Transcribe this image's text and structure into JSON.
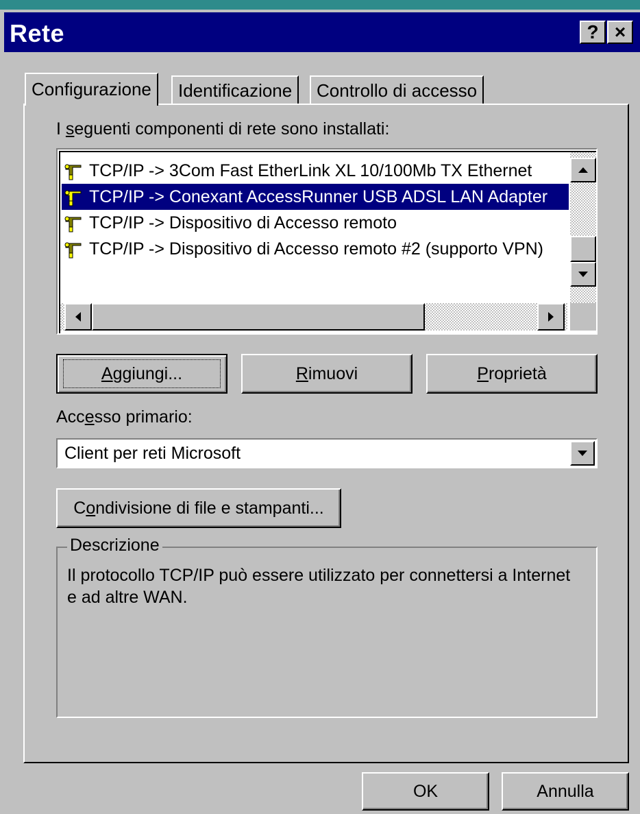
{
  "window": {
    "title": "Rete",
    "help_button": "?",
    "close_button": "×"
  },
  "tabs": [
    {
      "label": "Configurazione",
      "active": true
    },
    {
      "label": "Identificazione",
      "active": false
    },
    {
      "label": "Controllo di accesso",
      "active": false
    }
  ],
  "components": {
    "label_prefix": "I ",
    "label_u": "s",
    "label_rest": "eguenti componenti di rete sono installati:",
    "items": [
      {
        "text": "TCP/IP -> 3Com Fast EtherLink XL 10/100Mb TX Ethernet",
        "selected": false,
        "icon": "network-protocol-icon"
      },
      {
        "text": "TCP/IP -> Conexant AccessRunner USB ADSL LAN Adapter",
        "selected": true,
        "icon": "network-protocol-icon"
      },
      {
        "text": "TCP/IP -> Dispositivo di Accesso remoto",
        "selected": false,
        "icon": "network-protocol-icon"
      },
      {
        "text": "TCP/IP -> Dispositivo di Accesso remoto #2 (supporto VPN)",
        "selected": false,
        "icon": "network-protocol-icon"
      }
    ]
  },
  "buttons": {
    "add_u": "A",
    "add_rest": "ggiungi...",
    "remove_u": "R",
    "remove_rest": "imuovi",
    "properties_u": "P",
    "properties_rest": "roprietà"
  },
  "primary_access": {
    "label_a": "Acc",
    "label_u": "e",
    "label_b": "sso primario:",
    "value": "Client per reti Microsoft"
  },
  "sharing_button": {
    "a": "C",
    "u": "o",
    "b": "ndivisione di file e stampanti..."
  },
  "description": {
    "legend": "Descrizione",
    "text": "Il protocollo TCP/IP può essere utilizzato per connettersi a Internet e ad altre WAN."
  },
  "footer": {
    "ok": "OK",
    "cancel": "Annulla"
  },
  "colors": {
    "title_bar": "#000080",
    "face": "#c0c0c0",
    "selection": "#000080"
  }
}
